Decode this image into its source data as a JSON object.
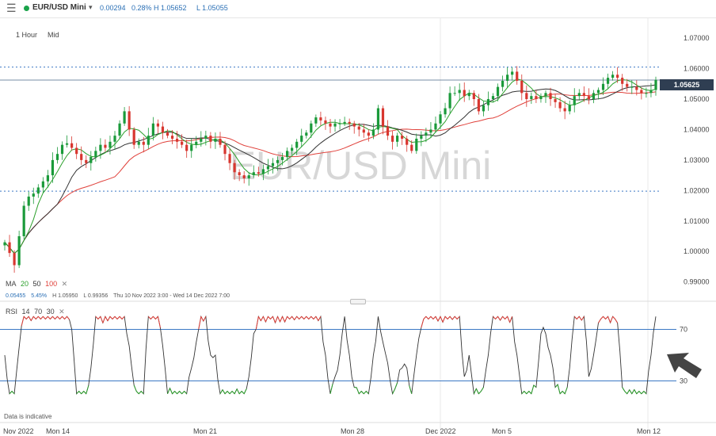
{
  "header": {
    "menu_icon": "hamburger-menu-icon",
    "symbol": "EUR/USD Mini",
    "chevron": "▾",
    "change": "0.00294",
    "change_pct": "0.28%",
    "high": "H 1.05652",
    "low": "L 1.05055",
    "status_color": "#1aa34a"
  },
  "timeframe": {
    "interval": "1 Hour",
    "price_type": "Mid"
  },
  "watermark": "EUR/USD Mini",
  "current_price": "1.05625",
  "ma_legend": {
    "label": "MA",
    "p1": "20",
    "p2": "50",
    "p3": "100",
    "colors": [
      "#2ca02c",
      "#333333",
      "#e0403a"
    ]
  },
  "stats": {
    "change": "0.05455",
    "change_pct": "5.45%",
    "high": "H 1.05950",
    "low": "L 0.99356",
    "range": "Thu 10 Nov 2022 3:00 - Wed 14 Dec 2022 7:00"
  },
  "rsi_legend": {
    "label": "RSI",
    "period": "14",
    "upper": "70",
    "lower": "30"
  },
  "footer_note": "Data is indicative",
  "chart_data": [
    {
      "type": "candlestick",
      "title": "EUR/USD Mini",
      "y_tick_labels": [
        "1.07000",
        "1.06000",
        "1.05000",
        "1.04000",
        "1.03000",
        "1.02000",
        "1.01000",
        "1.00000",
        "0.99000"
      ],
      "y_ticks": [
        1.07,
        1.06,
        1.05,
        1.04,
        1.03,
        1.02,
        1.01,
        1.0,
        0.99
      ],
      "ylim": [
        0.9847,
        1.0768
      ],
      "x_tick_labels": [
        "Nov 2022",
        "Mon 14",
        "Mon 21",
        "Mon 28",
        "Dec 2022",
        "Mon 5",
        "Mon 12"
      ],
      "horizontal_levels": [
        1.0605,
        1.0198
      ],
      "last_price": 1.05625,
      "series_close": [
        1.003,
        0.9995,
        0.9955,
        1.005,
        1.015,
        1.018,
        1.019,
        1.021,
        1.023,
        1.025,
        1.03,
        1.032,
        1.035,
        1.0355,
        1.034,
        1.032,
        1.03,
        1.029,
        1.031,
        1.033,
        1.035,
        1.034,
        1.036,
        1.038,
        1.042,
        1.046,
        1.04,
        1.035,
        1.036,
        1.035,
        1.038,
        1.042,
        1.041,
        1.039,
        1.038,
        1.037,
        1.036,
        1.035,
        1.033,
        1.035,
        1.036,
        1.037,
        1.038,
        1.036,
        1.037,
        1.035,
        1.032,
        1.029,
        1.026,
        1.025,
        1.024,
        1.025,
        1.026,
        1.0255,
        1.027,
        1.028,
        1.029,
        1.03,
        1.031,
        1.033,
        1.034,
        1.036,
        1.038,
        1.039,
        1.042,
        1.044,
        1.043,
        1.042,
        1.041,
        1.042,
        1.042,
        1.0425,
        1.042,
        1.041,
        1.04,
        1.039,
        1.038,
        1.04,
        1.047,
        1.041,
        1.038,
        1.036,
        1.038,
        1.037,
        1.035,
        1.033,
        1.037,
        1.038,
        1.039,
        1.04,
        1.042,
        1.045,
        1.047,
        1.052,
        1.052,
        1.053,
        1.051,
        1.052,
        1.05,
        1.046,
        1.048,
        1.05,
        1.051,
        1.054,
        1.056,
        1.058,
        1.059,
        1.056,
        1.052,
        1.05,
        1.051,
        1.05,
        1.051,
        1.052,
        1.05,
        1.049,
        1.047,
        1.046,
        1.048,
        1.051,
        1.052,
        1.051,
        1.05,
        1.052,
        1.053,
        1.055,
        1.057,
        1.058,
        1.057,
        1.055,
        1.054,
        1.054,
        1.053,
        1.052,
        1.052,
        1.053,
        1.0563
      ],
      "series": [
        {
          "name": "MA 20",
          "color": "#2ca02c"
        },
        {
          "name": "MA 50",
          "color": "#333333"
        },
        {
          "name": "MA 100",
          "color": "#e0403a"
        }
      ]
    },
    {
      "type": "line",
      "title": "RSI 14",
      "ylim": [
        18,
        82
      ],
      "y_tick_labels": [
        "70",
        "30"
      ],
      "y_ticks": [
        70,
        30
      ],
      "overbought_color": "#e0403a",
      "oversold_color": "#2ca02c",
      "line_color": "#333333",
      "annotation": "arrow-pointing-at-rsi-icon"
    }
  ]
}
